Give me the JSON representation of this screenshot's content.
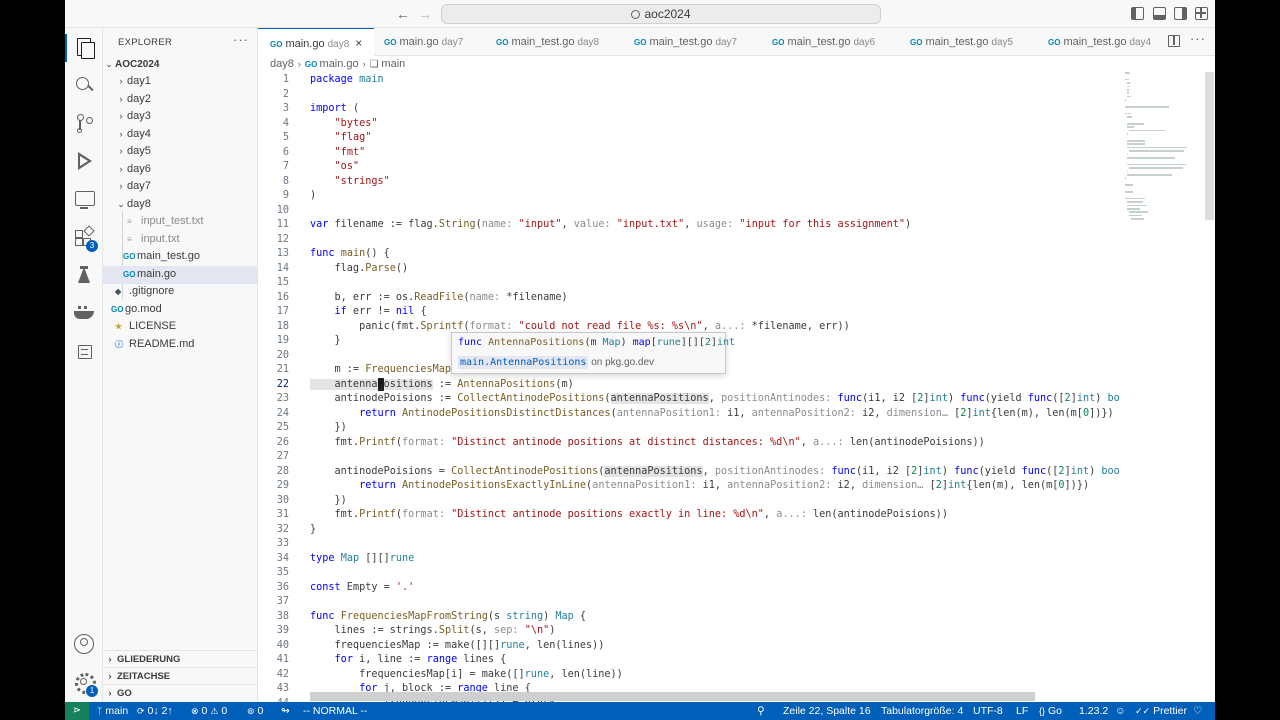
{
  "window": {
    "search": "aoc2024"
  },
  "activity": {
    "extensions_badge": "3",
    "manage_badge": "1"
  },
  "explorer": {
    "header": "EXPLORER",
    "more": "···",
    "root": "AOC2024",
    "folders": [
      "day1",
      "day2",
      "day3",
      "day4",
      "day5",
      "day6",
      "day7",
      "day8"
    ],
    "day8_files": [
      {
        "name": "input_test.txt",
        "icon": "txt-file-icon"
      },
      {
        "name": "input.txt",
        "icon": "txt-file-icon"
      },
      {
        "name": "main_test.go",
        "icon": "go-file-icon"
      },
      {
        "name": "main.go",
        "icon": "go-file-icon"
      }
    ],
    "root_files": [
      {
        "name": ".gitignore",
        "icon": "git-icon"
      },
      {
        "name": "go.mod",
        "icon": "go-mod-icon"
      },
      {
        "name": "LICENSE",
        "icon": "license-icon"
      },
      {
        "name": "README.md",
        "icon": "info-icon"
      }
    ],
    "sections": [
      "GLIEDERUNG",
      "ZEITACHSE",
      "GO"
    ]
  },
  "tabs": [
    {
      "name": "main.go",
      "desc": "day8",
      "active": true
    },
    {
      "name": "main.go",
      "desc": "day7"
    },
    {
      "name": "main_test.go",
      "desc": "day8"
    },
    {
      "name": "main_test.go",
      "desc": "day7"
    },
    {
      "name": "main_test.go",
      "desc": "day6"
    },
    {
      "name": "main_test.go",
      "desc": "day5"
    },
    {
      "name": "main_test.go",
      "desc": "day4"
    }
  ],
  "breadcrumb": {
    "folder": "day8",
    "file": "main.go",
    "symbol": "main"
  },
  "code": {
    "cursor_line": 22,
    "lines": [
      [
        [
          "k",
          "package"
        ],
        [
          "p",
          " "
        ],
        [
          "t",
          "main"
        ]
      ],
      [],
      [
        [
          "k",
          "import"
        ],
        [
          "p",
          " ("
        ]
      ],
      [
        [
          "p",
          "    "
        ],
        [
          "s",
          "\"bytes\""
        ]
      ],
      [
        [
          "p",
          "    "
        ],
        [
          "s",
          "\"flag\""
        ]
      ],
      [
        [
          "p",
          "    "
        ],
        [
          "s",
          "\"fmt\""
        ]
      ],
      [
        [
          "p",
          "    "
        ],
        [
          "s",
          "\"os\""
        ]
      ],
      [
        [
          "p",
          "    "
        ],
        [
          "s",
          "\"strings\""
        ]
      ],
      [
        [
          "p",
          ")"
        ]
      ],
      [],
      [
        [
          "k",
          "var"
        ],
        [
          "p",
          " filename := flag."
        ],
        [
          "f",
          "String"
        ],
        [
          "p",
          "("
        ],
        [
          "h",
          "name: "
        ],
        [
          "s",
          "\"input\""
        ],
        [
          "p",
          ", "
        ],
        [
          "h",
          "value: "
        ],
        [
          "s",
          "\"input.txt\""
        ],
        [
          "p",
          ", "
        ],
        [
          "h",
          "usage: "
        ],
        [
          "s",
          "\"input for this assignment\""
        ],
        [
          "p",
          ")"
        ]
      ],
      [],
      [
        [
          "k",
          "func"
        ],
        [
          "p",
          " "
        ],
        [
          "f",
          "main"
        ],
        [
          "p",
          "() {"
        ]
      ],
      [
        [
          "p",
          "    flag."
        ],
        [
          "f",
          "Parse"
        ],
        [
          "p",
          "()"
        ]
      ],
      [],
      [
        [
          "p",
          "    b, err := os."
        ],
        [
          "f",
          "ReadFile"
        ],
        [
          "p",
          "("
        ],
        [
          "h",
          "name: "
        ],
        [
          "p",
          "*filename)"
        ]
      ],
      [
        [
          "p",
          "    "
        ],
        [
          "k",
          "if"
        ],
        [
          "p",
          " err != "
        ],
        [
          "k",
          "nil"
        ],
        [
          "p",
          " {"
        ]
      ],
      [
        [
          "p",
          "        panic(fmt."
        ],
        [
          "f",
          "Sprintf"
        ],
        [
          "p",
          "("
        ],
        [
          "h",
          "format: "
        ],
        [
          "s",
          "\"could not read file %s: %s\\n\""
        ],
        [
          "p",
          ", "
        ],
        [
          "h",
          "a...: "
        ],
        [
          "p",
          "*filename, err))"
        ]
      ],
      [
        [
          "p",
          "    }"
        ]
      ],
      [],
      [
        [
          "p",
          "    m := "
        ],
        [
          "f",
          "FrequenciesMapFromString"
        ],
        [
          "p",
          "(string(b))"
        ]
      ],
      [
        [
          "w",
          "    antennaPositions"
        ],
        [
          "p",
          " := "
        ],
        [
          "f",
          "AntennaPositions"
        ],
        [
          "p",
          "(m)"
        ]
      ],
      [
        [
          "p",
          "    antinodePoisions := "
        ],
        [
          "f",
          "CollectAntinodePositions"
        ],
        [
          "p",
          "("
        ],
        [
          "w",
          "antennaPositions"
        ],
        [
          "p",
          ", "
        ],
        [
          "h",
          "positionAntinodes: "
        ],
        [
          "k",
          "func"
        ],
        [
          "p",
          "(i1, i2 ["
        ],
        [
          "n",
          "2"
        ],
        [
          "p",
          "]"
        ],
        [
          "t",
          "int"
        ],
        [
          "p",
          ") "
        ],
        [
          "k",
          "func"
        ],
        [
          "p",
          "(yield "
        ],
        [
          "k",
          "func"
        ],
        [
          "p",
          "(["
        ],
        [
          "n",
          "2"
        ],
        [
          "p",
          "]"
        ],
        [
          "t",
          "int"
        ],
        [
          "p",
          ") "
        ],
        [
          "t",
          "bool"
        ],
        [
          "p",
          ") {"
        ]
      ],
      [
        [
          "p",
          "        "
        ],
        [
          "k",
          "return"
        ],
        [
          "p",
          " "
        ],
        [
          "f",
          "AntinodePositionsDistinctDistances"
        ],
        [
          "p",
          "("
        ],
        [
          "h",
          "antennaPosition1: "
        ],
        [
          "p",
          "i1, "
        ],
        [
          "h",
          "antennaPosition2: "
        ],
        [
          "p",
          "i2, "
        ],
        [
          "h",
          "dimension… "
        ],
        [
          "p",
          "["
        ],
        [
          "n",
          "2"
        ],
        [
          "p",
          "]"
        ],
        [
          "t",
          "int"
        ],
        [
          "p",
          "{len(m), len(m["
        ],
        [
          "n",
          "0"
        ],
        [
          "p",
          "])})"
        ]
      ],
      [
        [
          "p",
          "    })"
        ]
      ],
      [
        [
          "p",
          "    fmt."
        ],
        [
          "f",
          "Printf"
        ],
        [
          "p",
          "("
        ],
        [
          "h",
          "format: "
        ],
        [
          "s",
          "\"Distinct antinode positions at distinct distances: %d\\n\""
        ],
        [
          "p",
          ", "
        ],
        [
          "h",
          "a...: "
        ],
        [
          "p",
          "len(antinodePoisions))"
        ]
      ],
      [],
      [
        [
          "p",
          "    antinodePoisions = "
        ],
        [
          "f",
          "CollectAntinodePositions"
        ],
        [
          "p",
          "("
        ],
        [
          "w",
          "antennaPositions"
        ],
        [
          "p",
          ", "
        ],
        [
          "h",
          "positionAntinodes: "
        ],
        [
          "k",
          "func"
        ],
        [
          "p",
          "(i1, i2 ["
        ],
        [
          "n",
          "2"
        ],
        [
          "p",
          "]"
        ],
        [
          "t",
          "int"
        ],
        [
          "p",
          ") "
        ],
        [
          "k",
          "func"
        ],
        [
          "p",
          "(yield "
        ],
        [
          "k",
          "func"
        ],
        [
          "p",
          "(["
        ],
        [
          "n",
          "2"
        ],
        [
          "p",
          "]"
        ],
        [
          "t",
          "int"
        ],
        [
          "p",
          ") "
        ],
        [
          "t",
          "bool"
        ],
        [
          "p",
          ") {"
        ]
      ],
      [
        [
          "p",
          "        "
        ],
        [
          "k",
          "return"
        ],
        [
          "p",
          " "
        ],
        [
          "f",
          "AntinodePositionsExactlyInLine"
        ],
        [
          "p",
          "("
        ],
        [
          "h",
          "antennaPosition1: "
        ],
        [
          "p",
          "i1, "
        ],
        [
          "h",
          "antennaPosition2: "
        ],
        [
          "p",
          "i2, "
        ],
        [
          "h",
          "dimension… "
        ],
        [
          "p",
          "["
        ],
        [
          "n",
          "2"
        ],
        [
          "p",
          "]"
        ],
        [
          "t",
          "int"
        ],
        [
          "p",
          "{len(m), len(m["
        ],
        [
          "n",
          "0"
        ],
        [
          "p",
          "])})"
        ]
      ],
      [
        [
          "p",
          "    })"
        ]
      ],
      [
        [
          "p",
          "    fmt."
        ],
        [
          "f",
          "Printf"
        ],
        [
          "p",
          "("
        ],
        [
          "h",
          "format: "
        ],
        [
          "s",
          "\"Distinct antinode positions exactly in line: %d\\n\""
        ],
        [
          "p",
          ", "
        ],
        [
          "h",
          "a...: "
        ],
        [
          "p",
          "len(antinodePoisions))"
        ]
      ],
      [
        [
          "p",
          "}"
        ]
      ],
      [],
      [
        [
          "k",
          "type"
        ],
        [
          "p",
          " "
        ],
        [
          "t",
          "Map"
        ],
        [
          "p",
          " [][]"
        ],
        [
          "t",
          "rune"
        ]
      ],
      [],
      [
        [
          "k",
          "const"
        ],
        [
          "p",
          " Empty = "
        ],
        [
          "s",
          "'.'"
        ]
      ],
      [],
      [
        [
          "k",
          "func"
        ],
        [
          "p",
          " "
        ],
        [
          "f",
          "FrequenciesMapFromString"
        ],
        [
          "p",
          "(s "
        ],
        [
          "t",
          "string"
        ],
        [
          "p",
          ") "
        ],
        [
          "t",
          "Map"
        ],
        [
          "p",
          " {"
        ]
      ],
      [
        [
          "p",
          "    lines := strings."
        ],
        [
          "f",
          "Split"
        ],
        [
          "p",
          "(s, "
        ],
        [
          "h",
          "sep: "
        ],
        [
          "s",
          "\"\\n\""
        ],
        [
          "p",
          ")"
        ]
      ],
      [
        [
          "p",
          "    frequenciesMap := make([][]"
        ],
        [
          "t",
          "rune"
        ],
        [
          "p",
          ", len(lines))"
        ]
      ],
      [
        [
          "p",
          "    "
        ],
        [
          "k",
          "for"
        ],
        [
          "p",
          " i, line := "
        ],
        [
          "k",
          "range"
        ],
        [
          "p",
          " lines {"
        ]
      ],
      [
        [
          "p",
          "        frequenciesMap[i] = make([]"
        ],
        [
          "t",
          "rune"
        ],
        [
          "p",
          ", len(line))"
        ]
      ],
      [
        [
          "p",
          "        "
        ],
        [
          "k",
          "for"
        ],
        [
          "p",
          " j, block := "
        ],
        [
          "k",
          "range"
        ],
        [
          "p",
          " line {"
        ]
      ],
      [
        [
          "p",
          "            frequenciesMap[i][j] = block"
        ]
      ]
    ]
  },
  "hover": {
    "signature": [
      [
        "k",
        "func"
      ],
      [
        "p",
        " "
      ],
      [
        "f",
        "AntennaPositions"
      ],
      [
        "p",
        "(m "
      ],
      [
        "t",
        "Map"
      ],
      [
        "p",
        ") "
      ],
      [
        "k",
        "map"
      ],
      [
        "p",
        "["
      ],
      [
        "t",
        "rune"
      ],
      [
        "p",
        "][]["
      ],
      [
        "n",
        "2"
      ],
      [
        "p",
        "]"
      ],
      [
        "t",
        "int"
      ]
    ],
    "link_code": "main.AntennaPositions",
    "link_text": "on pkg.go.dev"
  },
  "status": {
    "branch": "main",
    "sync": "0↓ 2↑",
    "errors": "0",
    "warnings": "0",
    "ports": "0",
    "mode": "-- NORMAL --",
    "position": "Zeile 22, Spalte 16",
    "indent": "Tabulatorgröße: 4",
    "encoding": "UTF-8",
    "eol": "LF",
    "language": "Go",
    "go_version": "1.23.2",
    "formatter": "Prettier"
  }
}
